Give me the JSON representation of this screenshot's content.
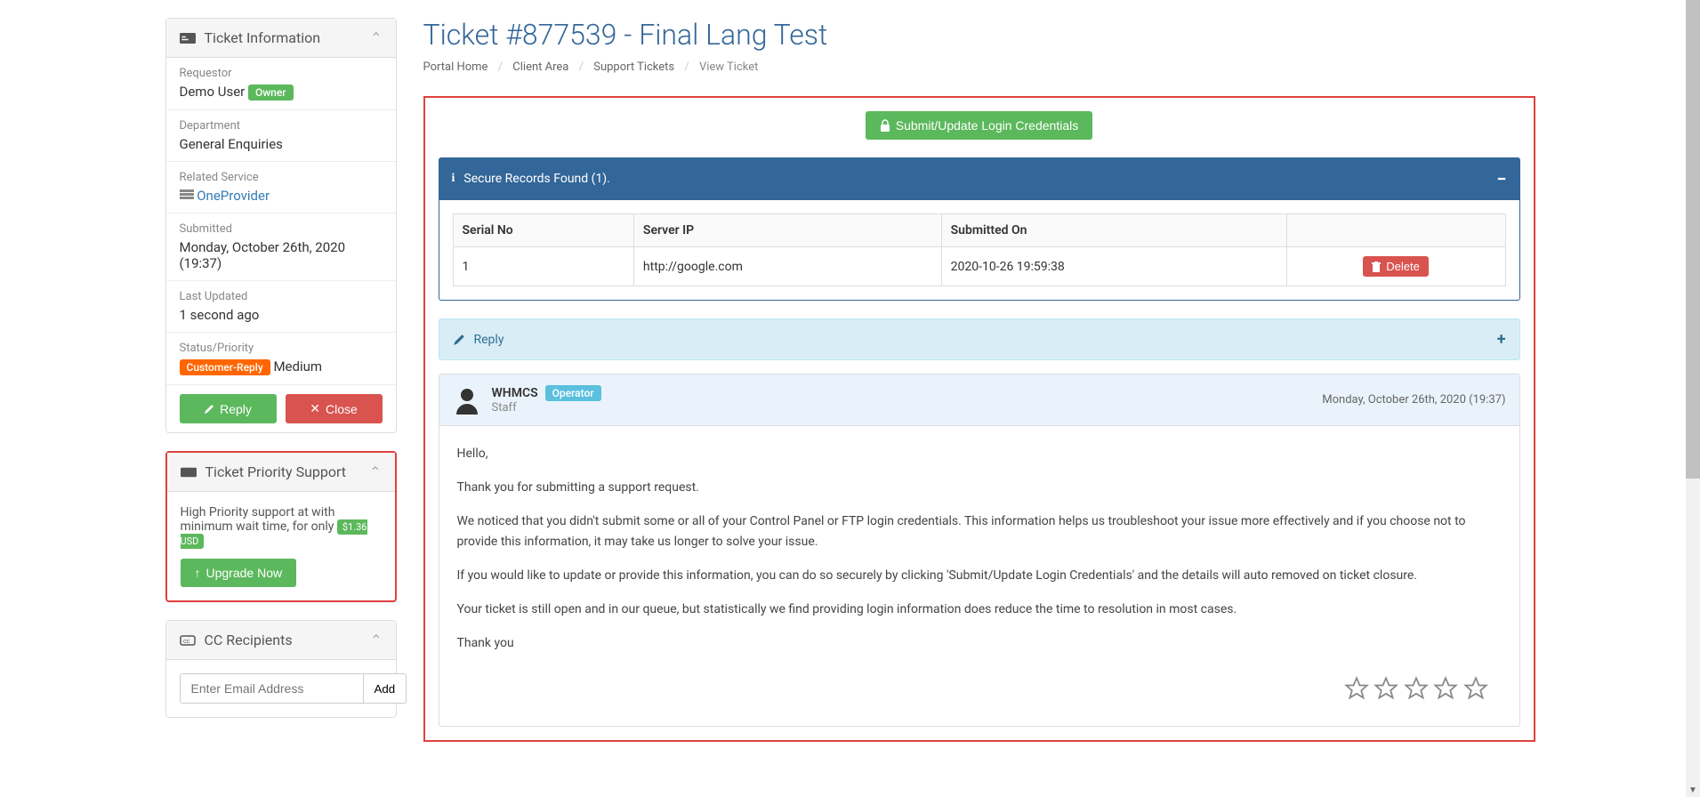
{
  "page": {
    "title": "Ticket #877539 - Final Lang Test"
  },
  "breadcrumb": {
    "portal": "Portal Home",
    "client": "Client Area",
    "tickets": "Support Tickets",
    "current": "View Ticket"
  },
  "ticketInfo": {
    "header": "Ticket Information",
    "requestor_label": "Requestor",
    "requestor_value": "Demo User",
    "owner_badge": "Owner",
    "department_label": "Department",
    "department_value": "General Enquiries",
    "related_label": "Related Service",
    "related_value": "OneProvider",
    "submitted_label": "Submitted",
    "submitted_value": "Monday, October 26th, 2020 (19:37)",
    "updated_label": "Last Updated",
    "updated_value": "1 second ago",
    "status_label": "Status/Priority",
    "status_badge": "Customer-Reply",
    "priority_value": "Medium",
    "reply_btn": "Reply",
    "close_btn": "Close"
  },
  "priority": {
    "header": "Ticket Priority Support",
    "text": "High Priority support at with minimum wait time, for only ",
    "price": "$1.36  USD",
    "upgrade_btn": "Upgrade Now"
  },
  "cc": {
    "header": "CC Recipients",
    "placeholder": "Enter Email Address",
    "add_btn": "Add"
  },
  "submitCred": {
    "label": "Submit/Update Login Credentials"
  },
  "secure": {
    "header": "Secure Records Found (1).",
    "col_serial": "Serial No",
    "col_ip": "Server IP",
    "col_submitted": "Submitted On",
    "rows": [
      {
        "serial": "1",
        "ip": "http://google.com",
        "submitted": "2020-10-26 19:59:38",
        "delete": "Delete"
      }
    ]
  },
  "reply": {
    "header": "Reply"
  },
  "message": {
    "author": "WHMCS",
    "operator_badge": "Operator",
    "role": "Staff",
    "date": "Monday, October 26th, 2020 (19:37)",
    "p1": "Hello,",
    "p2": "Thank you for submitting a support request.",
    "p3": "We noticed that you didn't submit some or all of your Control Panel or FTP login credentials. This information helps us troubleshoot your issue more effectively and if you choose not to provide this information, it may take us longer to solve your issue.",
    "p4": "If you would like to update or provide this information, you can do so securely by clicking 'Submit/Update Login Credentials' and the details will auto removed on ticket closure.",
    "p5": "Your ticket is still open and in our queue, but statistically we find providing login information does reduce the time to resolution in most cases.",
    "p6": "Thank you"
  }
}
